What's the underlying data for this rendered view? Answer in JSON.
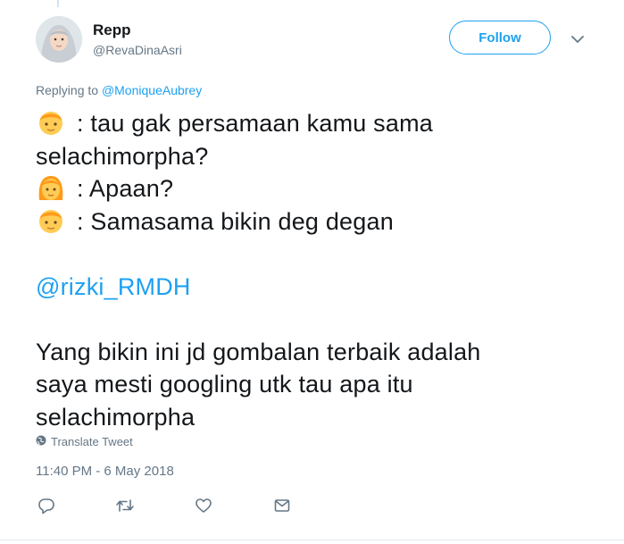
{
  "author": {
    "display_name": "Repp",
    "username": "@RevaDinaAsri"
  },
  "follow_button": {
    "label": "Follow"
  },
  "reply_context": {
    "prefix": "Replying to",
    "mention": "@MoniqueAubrey"
  },
  "tweet": {
    "lines": [
      {
        "emoji": "man-emoji",
        "text": ": tau gak persamaan kamu sama"
      },
      {
        "emoji": null,
        "text": "selachimorpha?"
      },
      {
        "emoji": "woman-emoji",
        "text": ": Apaan?"
      },
      {
        "emoji": "man-emoji",
        "text": ": Samasama bikin deg degan"
      },
      {
        "emoji": null,
        "text": ""
      },
      {
        "emoji": null,
        "mention": "@rizki_RMDH"
      },
      {
        "emoji": null,
        "text": ""
      },
      {
        "emoji": null,
        "text": "Yang bikin ini jd gombalan terbaik adalah"
      },
      {
        "emoji": null,
        "text": "saya mesti googling utk tau apa itu"
      },
      {
        "emoji": null,
        "text": "selachimorpha"
      }
    ]
  },
  "translate_label": "Translate Tweet",
  "timestamp": "11:40 PM - 6 May 2018",
  "actions": [
    "reply-icon",
    "retweet-icon",
    "like-icon",
    "direct-message-icon"
  ],
  "colors": {
    "accent": "#1da1f2",
    "secondary_text": "#657786",
    "primary_text": "#14171a"
  }
}
